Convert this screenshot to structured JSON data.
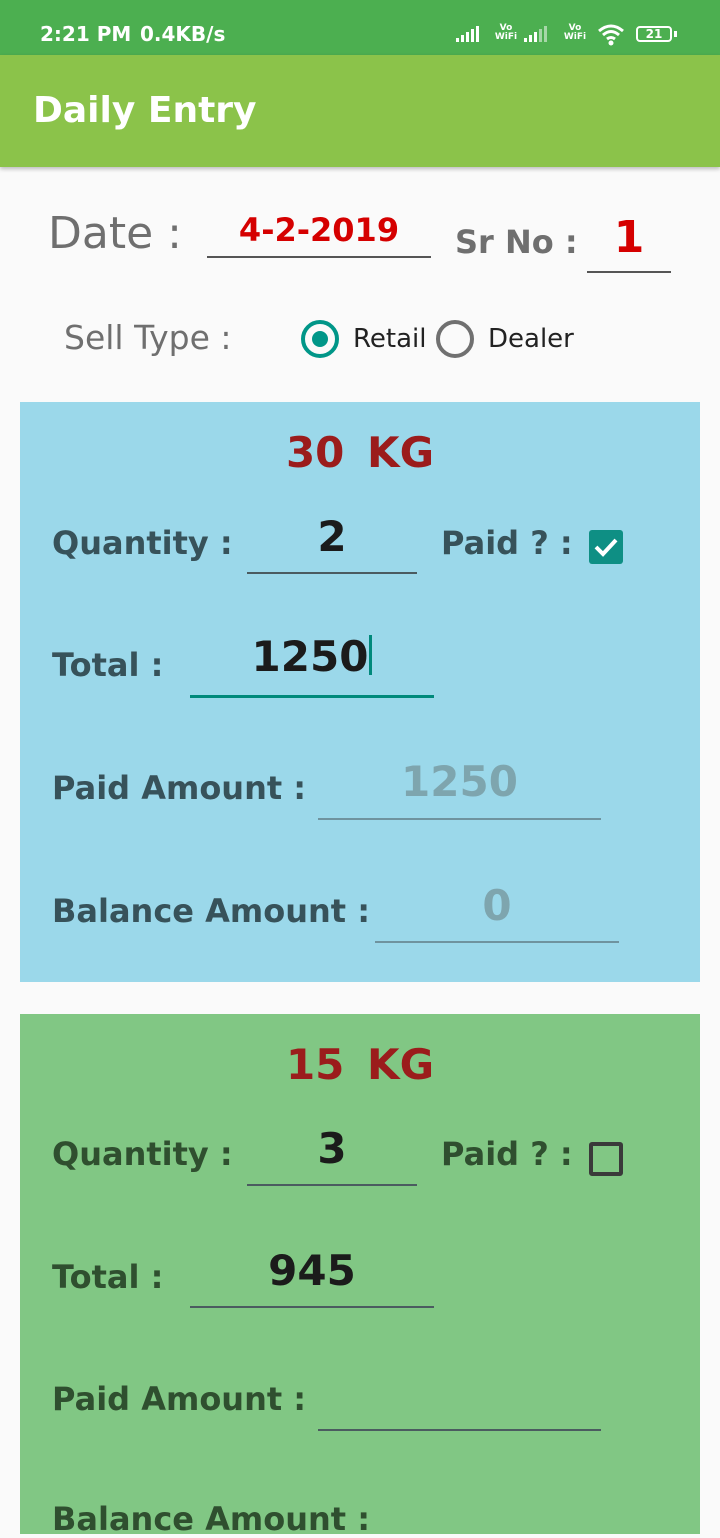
{
  "status_bar": {
    "time": "2:21 PM",
    "network_speed": "0.4KB/s",
    "vowifi_1": "Vo WiFi",
    "vowifi_2": "Vo WiFi",
    "battery": "21"
  },
  "app_bar": {
    "title": "Daily Entry"
  },
  "header": {
    "date_label": "Date :",
    "date_value": "4-2-2019",
    "srno_label": "Sr No :",
    "srno_value": "1",
    "sell_type_label": "Sell Type :",
    "sell_type_options": [
      {
        "label": "Retail",
        "selected": true
      },
      {
        "label": "Dealer",
        "selected": false
      }
    ]
  },
  "cards": [
    {
      "title": "30  KG",
      "background": "#9bd8ea",
      "quantity_label": "Quantity :",
      "quantity": "2",
      "paid_label": "Paid ? :",
      "paid_checked": true,
      "total_label": "Total :",
      "total": "1250",
      "paid_amount_label": "Paid Amount :",
      "paid_amount_hint": "1250",
      "balance_amount_label": "Balance Amount :",
      "balance_amount_hint": "0"
    },
    {
      "title": "15  KG",
      "background": "#81c784",
      "quantity_label": "Quantity :",
      "quantity": "3",
      "paid_label": "Paid ? :",
      "paid_checked": false,
      "total_label": "Total :",
      "total": "945",
      "paid_amount_label": "Paid Amount :",
      "paid_amount_hint": "",
      "balance_amount_label": "Balance Amount :"
    }
  ],
  "colors": {
    "status_bar": "#4caf50",
    "app_bar": "#8bc34a",
    "accent": "#009688",
    "header_value": "#d50000",
    "card_title": "#9b1c1c"
  }
}
